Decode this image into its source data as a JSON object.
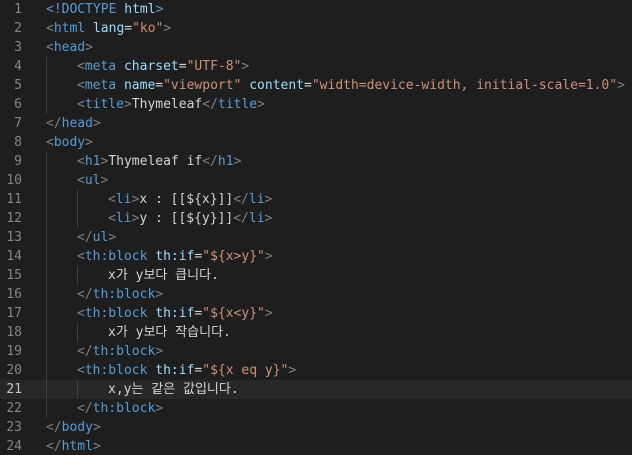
{
  "editor": {
    "active_line": 21,
    "lines": [
      {
        "n": "1",
        "indent": 0,
        "tokens": [
          {
            "t": "<!DOCTYPE",
            "c": "t-tag"
          },
          {
            "t": " html",
            "c": "t-attr"
          },
          {
            "t": ">",
            "c": "t-tag"
          }
        ]
      },
      {
        "n": "2",
        "indent": 0,
        "tokens": [
          {
            "t": "<",
            "c": "t-punct"
          },
          {
            "t": "html",
            "c": "t-tag"
          },
          {
            "t": " lang",
            "c": "t-attr"
          },
          {
            "t": "=",
            "c": "t-text"
          },
          {
            "t": "\"ko\"",
            "c": "t-str"
          },
          {
            "t": ">",
            "c": "t-punct"
          }
        ]
      },
      {
        "n": "3",
        "indent": 0,
        "tokens": [
          {
            "t": "<",
            "c": "t-punct"
          },
          {
            "t": "head",
            "c": "t-tag"
          },
          {
            "t": ">",
            "c": "t-punct"
          }
        ]
      },
      {
        "n": "4",
        "indent": 1,
        "tokens": [
          {
            "t": "<",
            "c": "t-punct"
          },
          {
            "t": "meta",
            "c": "t-tag"
          },
          {
            "t": " charset",
            "c": "t-attr"
          },
          {
            "t": "=",
            "c": "t-text"
          },
          {
            "t": "\"UTF-8\"",
            "c": "t-str"
          },
          {
            "t": ">",
            "c": "t-punct"
          }
        ]
      },
      {
        "n": "5",
        "indent": 1,
        "tokens": [
          {
            "t": "<",
            "c": "t-punct"
          },
          {
            "t": "meta",
            "c": "t-tag"
          },
          {
            "t": " name",
            "c": "t-attr"
          },
          {
            "t": "=",
            "c": "t-text"
          },
          {
            "t": "\"viewport\"",
            "c": "t-str"
          },
          {
            "t": " content",
            "c": "t-attr"
          },
          {
            "t": "=",
            "c": "t-text"
          },
          {
            "t": "\"width=device-width, initial-scale=1.0\"",
            "c": "t-str"
          },
          {
            "t": ">",
            "c": "t-punct"
          }
        ]
      },
      {
        "n": "6",
        "indent": 1,
        "tokens": [
          {
            "t": "<",
            "c": "t-punct"
          },
          {
            "t": "title",
            "c": "t-tag"
          },
          {
            "t": ">",
            "c": "t-punct"
          },
          {
            "t": "Thymeleaf",
            "c": "t-text"
          },
          {
            "t": "</",
            "c": "t-punct"
          },
          {
            "t": "title",
            "c": "t-tag"
          },
          {
            "t": ">",
            "c": "t-punct"
          }
        ]
      },
      {
        "n": "7",
        "indent": 0,
        "tokens": [
          {
            "t": "</",
            "c": "t-punct"
          },
          {
            "t": "head",
            "c": "t-tag"
          },
          {
            "t": ">",
            "c": "t-punct"
          }
        ]
      },
      {
        "n": "8",
        "indent": 0,
        "tokens": [
          {
            "t": "<",
            "c": "t-punct"
          },
          {
            "t": "body",
            "c": "t-tag"
          },
          {
            "t": ">",
            "c": "t-punct"
          }
        ]
      },
      {
        "n": "9",
        "indent": 1,
        "tokens": [
          {
            "t": "<",
            "c": "t-punct"
          },
          {
            "t": "h1",
            "c": "t-tag"
          },
          {
            "t": ">",
            "c": "t-punct"
          },
          {
            "t": "Thymeleaf if",
            "c": "t-text"
          },
          {
            "t": "</",
            "c": "t-punct"
          },
          {
            "t": "h1",
            "c": "t-tag"
          },
          {
            "t": ">",
            "c": "t-punct"
          }
        ]
      },
      {
        "n": "10",
        "indent": 1,
        "tokens": [
          {
            "t": "<",
            "c": "t-punct"
          },
          {
            "t": "ul",
            "c": "t-tag"
          },
          {
            "t": ">",
            "c": "t-punct"
          }
        ]
      },
      {
        "n": "11",
        "indent": 2,
        "tokens": [
          {
            "t": "<",
            "c": "t-punct"
          },
          {
            "t": "li",
            "c": "t-tag"
          },
          {
            "t": ">",
            "c": "t-punct"
          },
          {
            "t": "x : [[${x}]]",
            "c": "t-text"
          },
          {
            "t": "</",
            "c": "t-punct"
          },
          {
            "t": "li",
            "c": "t-tag"
          },
          {
            "t": ">",
            "c": "t-punct"
          }
        ]
      },
      {
        "n": "12",
        "indent": 2,
        "tokens": [
          {
            "t": "<",
            "c": "t-punct"
          },
          {
            "t": "li",
            "c": "t-tag"
          },
          {
            "t": ">",
            "c": "t-punct"
          },
          {
            "t": "y : [[${y}]]",
            "c": "t-text"
          },
          {
            "t": "</",
            "c": "t-punct"
          },
          {
            "t": "li",
            "c": "t-tag"
          },
          {
            "t": ">",
            "c": "t-punct"
          }
        ]
      },
      {
        "n": "13",
        "indent": 1,
        "tokens": [
          {
            "t": "</",
            "c": "t-punct"
          },
          {
            "t": "ul",
            "c": "t-tag"
          },
          {
            "t": ">",
            "c": "t-punct"
          }
        ]
      },
      {
        "n": "14",
        "indent": 1,
        "tokens": [
          {
            "t": "<",
            "c": "t-punct"
          },
          {
            "t": "th:block",
            "c": "t-tag"
          },
          {
            "t": " th:if",
            "c": "t-attr"
          },
          {
            "t": "=",
            "c": "t-text"
          },
          {
            "t": "\"${x>y}\"",
            "c": "t-str"
          },
          {
            "t": ">",
            "c": "t-punct"
          }
        ]
      },
      {
        "n": "15",
        "indent": 2,
        "tokens": [
          {
            "t": "x가 y보다 큽니다.",
            "c": "t-text"
          }
        ]
      },
      {
        "n": "16",
        "indent": 1,
        "tokens": [
          {
            "t": "</",
            "c": "t-punct"
          },
          {
            "t": "th:block",
            "c": "t-tag"
          },
          {
            "t": ">",
            "c": "t-punct"
          }
        ]
      },
      {
        "n": "17",
        "indent": 1,
        "tokens": [
          {
            "t": "<",
            "c": "t-punct"
          },
          {
            "t": "th:block",
            "c": "t-tag"
          },
          {
            "t": " th:if",
            "c": "t-attr"
          },
          {
            "t": "=",
            "c": "t-text"
          },
          {
            "t": "\"${x<y}\"",
            "c": "t-str"
          },
          {
            "t": ">",
            "c": "t-punct"
          }
        ]
      },
      {
        "n": "18",
        "indent": 2,
        "tokens": [
          {
            "t": "x가 y보다 작습니다.",
            "c": "t-text"
          }
        ]
      },
      {
        "n": "19",
        "indent": 1,
        "tokens": [
          {
            "t": "</",
            "c": "t-punct"
          },
          {
            "t": "th:block",
            "c": "t-tag"
          },
          {
            "t": ">",
            "c": "t-punct"
          }
        ]
      },
      {
        "n": "20",
        "indent": 1,
        "tokens": [
          {
            "t": "<",
            "c": "t-punct"
          },
          {
            "t": "th:block",
            "c": "t-tag"
          },
          {
            "t": " th:if",
            "c": "t-attr"
          },
          {
            "t": "=",
            "c": "t-text"
          },
          {
            "t": "\"${x eq y}\"",
            "c": "t-str"
          },
          {
            "t": ">",
            "c": "t-punct"
          }
        ]
      },
      {
        "n": "21",
        "indent": 2,
        "tokens": [
          {
            "t": "x,y는 같은 값입니다.",
            "c": "t-text"
          }
        ]
      },
      {
        "n": "22",
        "indent": 1,
        "tokens": [
          {
            "t": "</",
            "c": "t-punct"
          },
          {
            "t": "th:block",
            "c": "t-tag"
          },
          {
            "t": ">",
            "c": "t-punct"
          }
        ]
      },
      {
        "n": "23",
        "indent": 0,
        "tokens": [
          {
            "t": "</",
            "c": "t-punct"
          },
          {
            "t": "body",
            "c": "t-tag"
          },
          {
            "t": ">",
            "c": "t-punct"
          }
        ]
      },
      {
        "n": "24",
        "indent": 0,
        "tokens": [
          {
            "t": "</",
            "c": "t-punct"
          },
          {
            "t": "html",
            "c": "t-tag"
          },
          {
            "t": ">",
            "c": "t-punct"
          }
        ]
      }
    ]
  }
}
